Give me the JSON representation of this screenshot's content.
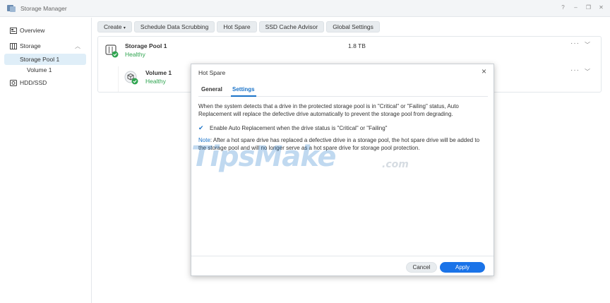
{
  "window": {
    "title": "Storage Manager",
    "controls": [
      "?",
      "–",
      "❐",
      "✕"
    ]
  },
  "sidebar": {
    "items": [
      {
        "label": "Overview",
        "icon": "overview-icon"
      },
      {
        "label": "Storage",
        "icon": "storage-icon"
      },
      {
        "label": "Storage Pool 1"
      },
      {
        "label": "Volume 1"
      },
      {
        "label": "HDD/SSD",
        "icon": "hdd-icon"
      }
    ]
  },
  "toolbar": {
    "buttons": [
      "Create",
      "Schedule Data Scrubbing",
      "Hot Spare",
      "SSD Cache Advisor",
      "Global Settings"
    ]
  },
  "pool": {
    "name": "Storage Pool 1",
    "status": "Healthy",
    "size": "1.8 TB",
    "volume": {
      "name": "Volume 1",
      "status": "Healthy"
    }
  },
  "dialog": {
    "title": "Hot Spare",
    "tabs": [
      "General",
      "Settings"
    ],
    "active_tab": "Settings",
    "description": "When the system detects that a drive in the protected storage pool is in \"Critical\" or \"Failing\" status, Auto Replacement will replace the defective drive automatically to prevent the storage pool from degrading.",
    "checkbox": {
      "label": "Enable Auto Replacement when the drive status is \"Critical\" or \"Failing\"",
      "checked": true
    },
    "note_label": "Note",
    "note_text": ": After a hot spare drive has replaced a defective drive in a storage pool, the hot spare drive will be added to the storage pool and will no longer serve as a hot spare drive for storage pool protection.",
    "cancel_label": "Cancel",
    "apply_label": "Apply"
  },
  "watermark": {
    "text": "TipsMake",
    "sub": ".com"
  },
  "colors": {
    "accent": "#1a73e8",
    "healthy": "#2ea44f",
    "selected_bg": "#dfeef8"
  }
}
